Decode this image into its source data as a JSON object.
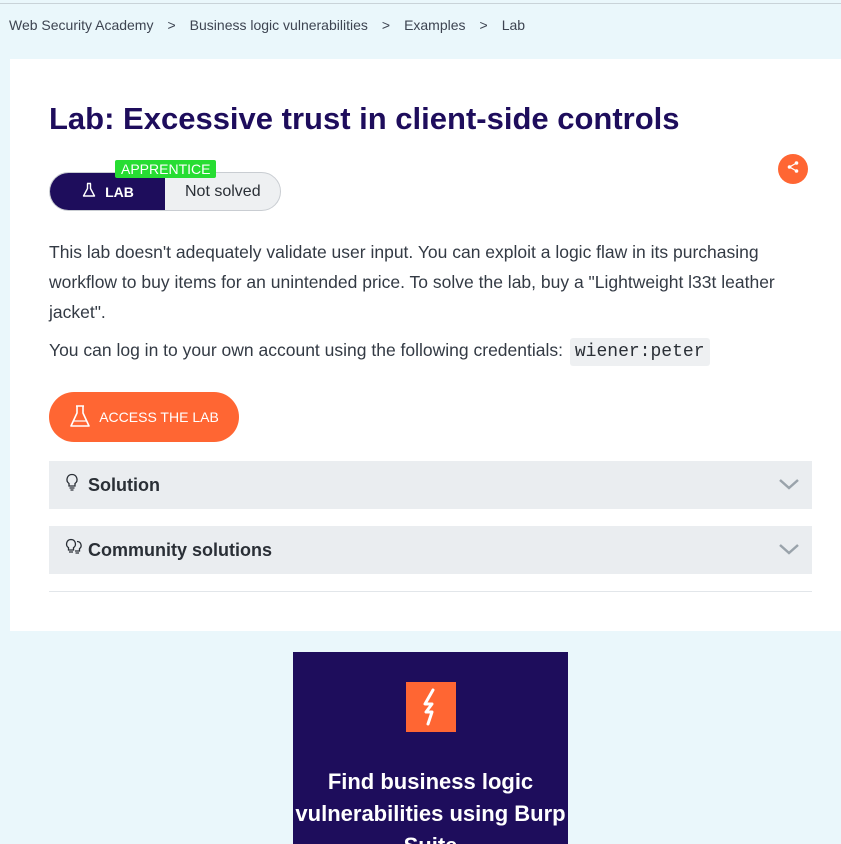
{
  "breadcrumb": [
    {
      "label": "Web Security Academy"
    },
    {
      "label": "Business logic vulnerabilities"
    },
    {
      "label": "Examples"
    },
    {
      "label": "Lab"
    }
  ],
  "breadcrumb_separator": ">",
  "lab": {
    "title": "Lab: Excessive trust in client-side controls",
    "level": "APPRENTICE",
    "type_label": "LAB",
    "status": "Not solved",
    "description": "This lab doesn't adequately validate user input. You can exploit a logic flaw in its purchasing workflow to buy items for an unintended price. To solve the lab, buy a \"Lightweight l33t leather jacket\".",
    "credentials_text": "You can log in to your own account using the following credentials:",
    "credentials_code": "wiener:peter",
    "access_button": "ACCESS THE LAB"
  },
  "accordions": [
    {
      "label": "Solution",
      "icon": "lightbulb-icon"
    },
    {
      "label": "Community solutions",
      "icon": "community-lightbulbs-icon"
    }
  ],
  "promo": {
    "text": "Find business logic vulnerabilities using Burp Suite"
  },
  "colors": {
    "accent": "#ff6633",
    "brand_navy": "#1e0d5c",
    "level_green": "#27dd32"
  }
}
